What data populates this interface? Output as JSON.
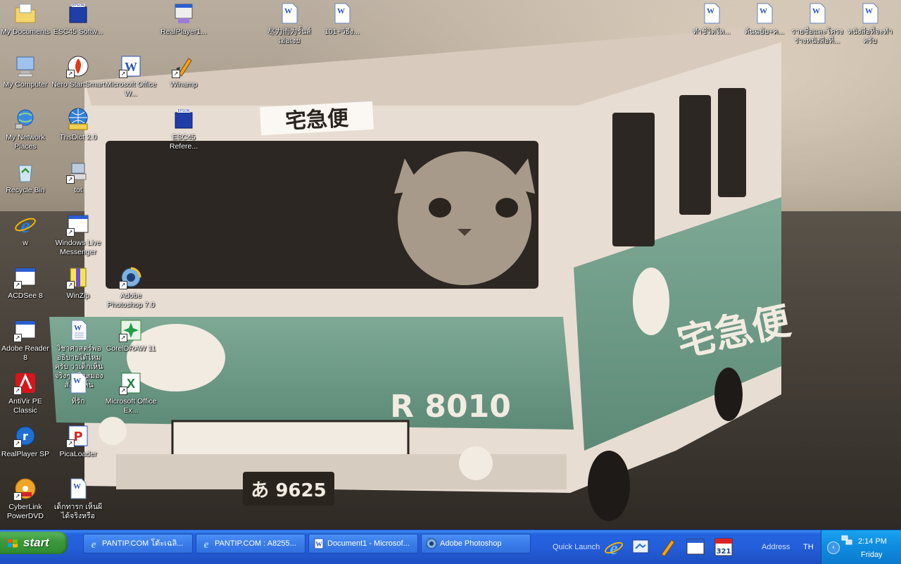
{
  "desktop": {
    "icons": [
      {
        "label": "My Documents",
        "icon": "folder-documents-icon"
      },
      {
        "label": "My Computer",
        "icon": "computer-icon"
      },
      {
        "label": "My Network Places",
        "icon": "network-icon"
      },
      {
        "label": "Recycle Bin",
        "icon": "recycle-bin-icon"
      },
      {
        "label": "w",
        "icon": "internet-explorer-icon"
      },
      {
        "label": "ACDSee 8",
        "icon": "app-window-icon"
      },
      {
        "label": "Adobe Reader 8",
        "icon": "app-window-icon"
      },
      {
        "label": "AntiVir PE Classic",
        "icon": "antivir-icon"
      },
      {
        "label": "RealPlayer SP",
        "icon": "realplayer-icon"
      },
      {
        "label": "CyberLink PowerDVD",
        "icon": "powerdvd-icon"
      },
      {
        "label": "ESC45 Softw...",
        "icon": "epson-book-icon"
      },
      {
        "label": "Nero StartSmart",
        "icon": "nero-icon"
      },
      {
        "label": "ThsDict 2.0",
        "icon": "globe-icon"
      },
      {
        "label": "tot",
        "icon": "computer-shortcut-icon"
      },
      {
        "label": "Windows Live Messenger",
        "icon": "app-window-icon"
      },
      {
        "label": "WinZip",
        "icon": "winzip-icon"
      },
      {
        "label": "วิชาศาสตร์พออธิบายได้ไหมครับ ว่าเด็กเห็นจริงๆ หรือสมองสั่งให้เห็น",
        "icon": "word-document-icon"
      },
      {
        "label": "ที่รัก",
        "icon": "word-document-icon"
      },
      {
        "label": "PicaLoader",
        "icon": "picaloader-icon"
      },
      {
        "label": "เด็กทารก เห็นผีได้จริงหรือ",
        "icon": "word-document-icon"
      },
      {
        "label": "Microsoft Office W...",
        "icon": "word-app-icon"
      },
      {
        "label": "Adobe Photoshop 7.0",
        "icon": "photoshop-icon"
      },
      {
        "label": "CorelDRAW 11",
        "icon": "coreldraw-icon"
      },
      {
        "label": "Microsoft Office Ex...",
        "icon": "excel-app-icon"
      },
      {
        "label": "RealPlayer1...",
        "icon": "realplayer-setup-icon"
      },
      {
        "label": "Winamp",
        "icon": "winamp-icon"
      },
      {
        "label": "ESC45 Refere...",
        "icon": "epson-book-icon"
      },
      {
        "label": "尽力而为รั้นส์เอ่อเงย",
        "icon": "word-document-icon"
      },
      {
        "label": "101+วิธีง...",
        "icon": "word-document-icon"
      },
      {
        "label": "ทำชีวิตให...",
        "icon": "word-document-icon"
      },
      {
        "label": "ต้นฉบับ+ค...",
        "icon": "word-document-icon"
      },
      {
        "label": "รายชื่อและโครงร่างหนังสือที่...",
        "icon": "word-document-icon"
      },
      {
        "label": "หนังสือที่จะทำครับ",
        "icon": "word-document-icon"
      }
    ],
    "wallpaper": {
      "sign_top": "宅急便",
      "plate_main": "R 8010",
      "plate_small": "あ 9625",
      "side_text": "宅急便"
    }
  },
  "taskbar": {
    "start_label": "start",
    "tasks": [
      {
        "label": "PANTIP.COM โต้ะเฉลิ...",
        "icon": "internet-explorer-icon"
      },
      {
        "label": "PANTIP.COM : A8255...",
        "icon": "internet-explorer-icon"
      },
      {
        "label": "Document1 - Microsof...",
        "icon": "word-document-icon"
      },
      {
        "label": "Adobe Photoshop",
        "icon": "photoshop-icon"
      }
    ],
    "quick_launch_label": "Quick Launch",
    "quick_launch_icons": [
      "internet-explorer-icon",
      "show-desktop-icon",
      "winamp-icon",
      "window-icon",
      "calendar-321-icon"
    ],
    "address_label": "Address",
    "language": "TH",
    "clock_time": "2:14 PM",
    "clock_day": "Friday",
    "colors": {
      "taskbar": "#245edb",
      "start": "#3c9a3c",
      "tray": "#0f8bde"
    }
  }
}
